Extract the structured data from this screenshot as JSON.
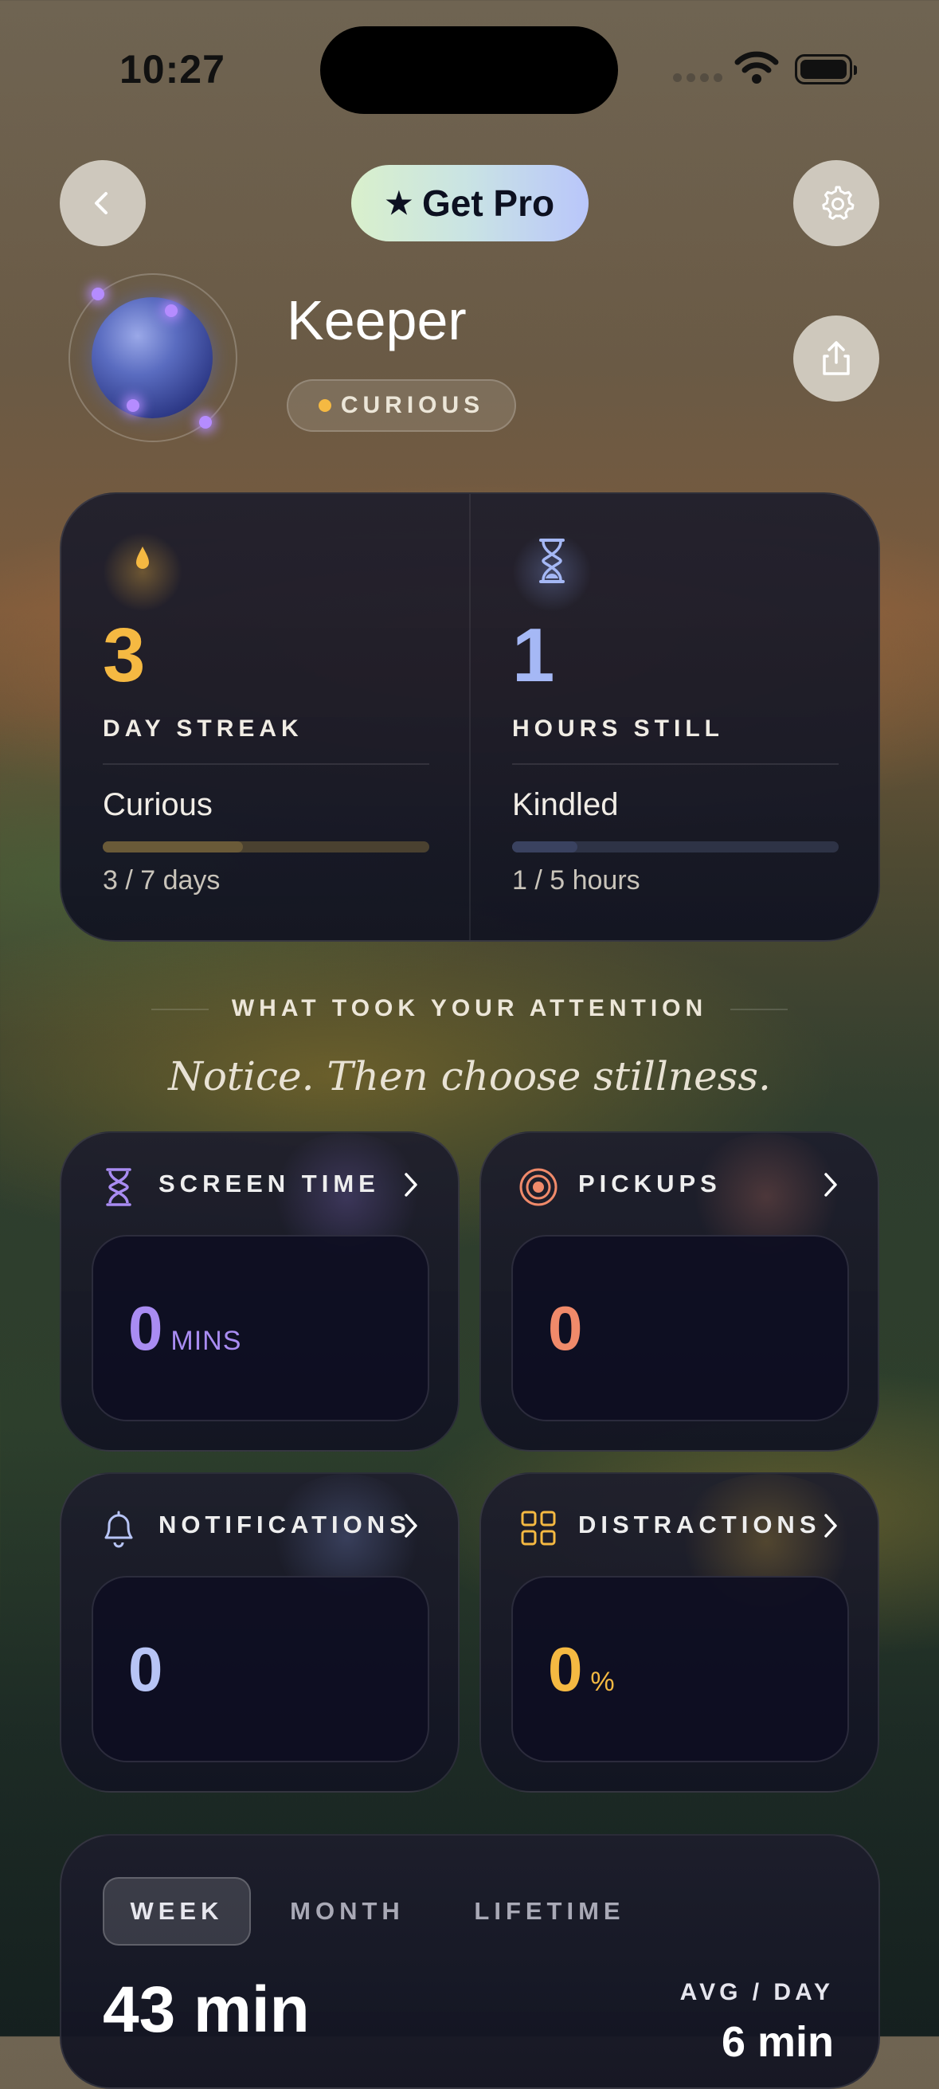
{
  "status_bar": {
    "time": "10:27"
  },
  "header": {
    "get_pro_label": "Get Pro",
    "get_pro_star": "★"
  },
  "profile": {
    "name": "Keeper",
    "badge": "CURIOUS"
  },
  "stats": {
    "streak": {
      "value": "3",
      "label": "DAY STREAK",
      "level": "Curious",
      "progress_text": "3 / 7 days",
      "progress": 0.43
    },
    "hours": {
      "value": "1",
      "label": "HOURS STILL",
      "level": "Kindled",
      "progress_text": "1 / 5 hours",
      "progress": 0.2
    }
  },
  "section": {
    "title": "WHAT TOOK YOUR ATTENTION",
    "tagline": "Notice. Then choose stillness."
  },
  "tiles": {
    "screen_time": {
      "label": "SCREEN TIME",
      "value": "0",
      "unit": "MINS"
    },
    "pickups": {
      "label": "PICKUPS",
      "value": "0"
    },
    "notifications": {
      "label": "NOTIFICATIONS",
      "value": "0"
    },
    "distractions": {
      "label": "DISTRACTIONS",
      "value": "0",
      "unit": "%"
    }
  },
  "summary": {
    "tabs": [
      "WEEK",
      "MONTH",
      "LIFETIME"
    ],
    "active_tab": "WEEK",
    "total": "43 min",
    "avg_label": "AVG / DAY",
    "avg_value": "6 min"
  },
  "colors": {
    "streak": "#f5b942",
    "hours": "#a5b8f5",
    "screen_time": "#a98cf2",
    "pickups": "#f08a6a",
    "notifications": "#b7c4f5",
    "distractions": "#f5b942"
  }
}
